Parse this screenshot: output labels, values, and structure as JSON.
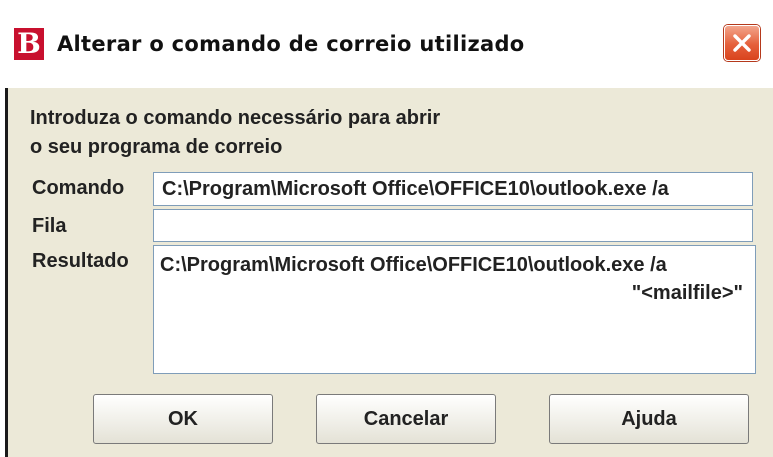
{
  "window": {
    "title": "Alterar o comando de correio utilizado",
    "icon_letter": "B",
    "icon_color": "#c8102e",
    "close_icon": "close-icon"
  },
  "dialog": {
    "instruction_line1": "Introduza o comando necessário para abrir",
    "instruction_line2": "o seu programa de correio",
    "fields": {
      "comando": {
        "label": "Comando",
        "value": "C:\\Program\\Microsoft Office\\OFFICE10\\outlook.exe /a"
      },
      "fila": {
        "label": "Fila",
        "value": ""
      },
      "resultado": {
        "label": "Resultado",
        "line1": "C:\\Program\\Microsoft Office\\OFFICE10\\outlook.exe /a",
        "line2": "\"<mailfile>\""
      }
    }
  },
  "buttons": {
    "ok": "OK",
    "cancel": "Cancelar",
    "help": "Ajuda"
  }
}
